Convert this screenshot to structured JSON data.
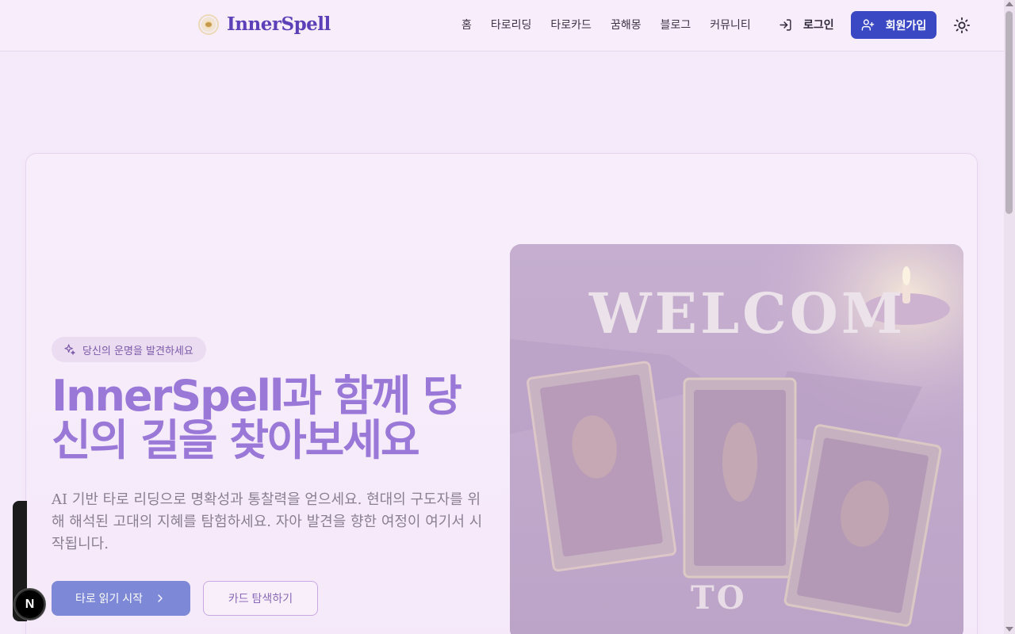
{
  "header": {
    "logo_text": "InnerSpell",
    "nav": [
      "홈",
      "타로리딩",
      "타로카드",
      "꿈해몽",
      "블로그",
      "커뮤니티"
    ],
    "login_label": "로그인",
    "signup_label": "회원가입"
  },
  "hero": {
    "badge": "당신의 운명을 발견하세요",
    "headline": "InnerSpell과 함께 당신의 길을 찾아보세요",
    "description": "AI 기반 타로 리딩으로 명확성과 통찰력을 얻으세요. 현대의 구도자를 위해 해석된 고대의 지혜를 탐험하세요. 자아 발견을 향한 여정이 여기서 시작됩니다.",
    "primary_button": "타로 읽기 시작",
    "secondary_button": "카드 탐색하기",
    "image_text_top": "WELCOM",
    "image_text_bottom": "TO"
  },
  "dev_badge": "N",
  "colors": {
    "brand": "#5b40b8",
    "signup_bg": "#3b48c4",
    "headline": "#9a78d8",
    "primary_button": "#7d88d6"
  }
}
